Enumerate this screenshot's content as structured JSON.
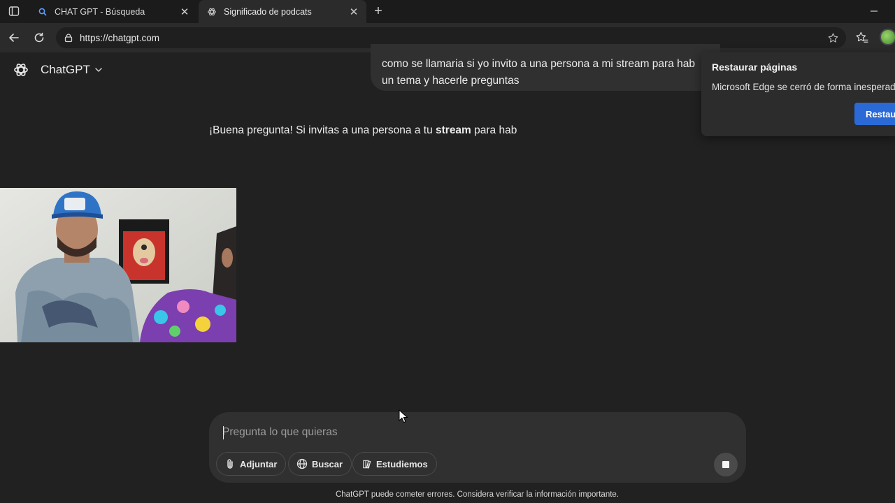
{
  "browser": {
    "tabs": [
      {
        "title": "CHAT GPT - Búsqueda",
        "icon": "search-icon",
        "active": false
      },
      {
        "title": "Significado de podcats",
        "icon": "chatgpt-icon",
        "active": true
      }
    ],
    "url": "https://chatgpt.com",
    "new_tab_label": "+"
  },
  "app": {
    "model_name": "ChatGPT"
  },
  "conversation": {
    "user_message_line1": "como se llamaria si yo invito a una persona a mi stream para hab",
    "user_message_line2": "un tema y hacerle preguntas",
    "assistant_prefix": "¡Buena pregunta! Si invitas a una persona a tu ",
    "assistant_bold": "stream",
    "assistant_suffix": " para hab"
  },
  "restore_popup": {
    "title": "Restaurar páginas",
    "text": "Microsoft Edge se cerró de forma inesperada.",
    "button": "Restaurar"
  },
  "composer": {
    "placeholder": "Pregunta lo que quieras",
    "value": "",
    "buttons": {
      "attach": "Adjuntar",
      "search": "Buscar",
      "study": "Estudiemos"
    }
  },
  "footer": {
    "disclaimer": "ChatGPT puede cometer errores. Considera verificar la información importante."
  },
  "colors": {
    "page_bg": "#212121",
    "bubble_bg": "#303030",
    "accent_button": "#2b6ad6"
  }
}
